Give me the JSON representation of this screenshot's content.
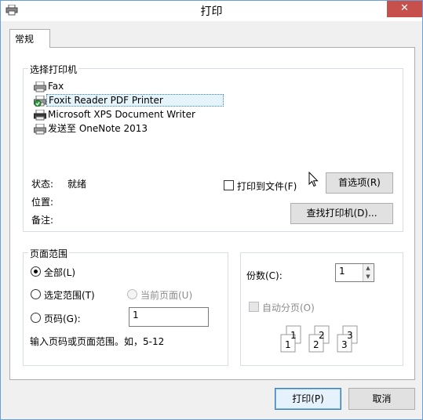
{
  "window": {
    "title": "打印",
    "close_glyph": "✕"
  },
  "tabs": [
    {
      "label": "常规"
    }
  ],
  "select_printer": {
    "legend": "选择打印机",
    "printers": [
      {
        "name": "Fax",
        "icon": "fax-printer-icon"
      },
      {
        "name": "Foxit Reader PDF Printer",
        "icon": "default-printer-icon",
        "selected": true
      },
      {
        "name": "Microsoft XPS Document Writer",
        "icon": "printer-icon"
      },
      {
        "name": "发送至 OneNote 2013",
        "icon": "printer-icon"
      }
    ],
    "status_label": "状态:",
    "status_value": "就绪",
    "location_label": "位置:",
    "comment_label": "备注:",
    "print_to_file_label": "打印到文件(F)",
    "preferences_button": "首选项(R)",
    "find_printer_button": "查找打印机(D)..."
  },
  "page_range": {
    "legend": "页面范围",
    "all_label": "全部(L)",
    "selection_label": "选定范围(T)",
    "current_page_label": "当前页面(U)",
    "pages_label": "页码(G):",
    "pages_value": "1",
    "hint": "输入页码或页面范围。如，5-12"
  },
  "copies": {
    "label": "份数(C):",
    "value": "1",
    "collate_label": "自动分页(O)",
    "collate_pages": [
      "1",
      "1",
      "2",
      "2",
      "3",
      "3"
    ]
  },
  "footer": {
    "print_button": "打印(P)",
    "cancel_button": "取消"
  },
  "colors": {
    "close_red": "#c7504c",
    "focus_blue": "#3c7fb1",
    "selection_bg": "#e5f3fb"
  }
}
